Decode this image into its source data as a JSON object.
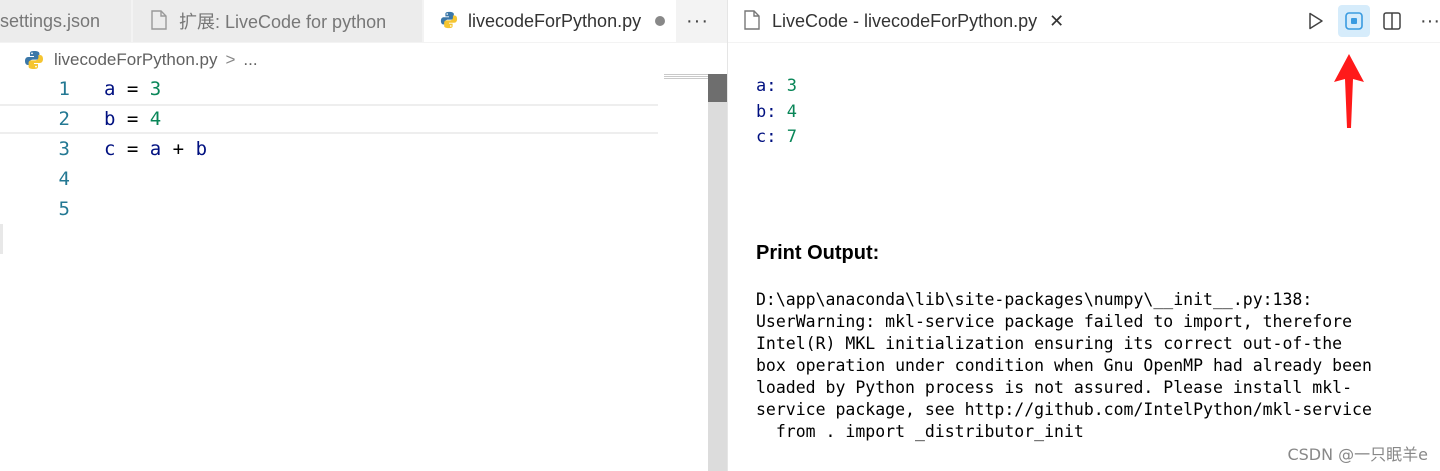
{
  "left_tabs": [
    {
      "label": "settings.json",
      "icon": "json-file-icon"
    },
    {
      "label": "扩展: LiveCode for python",
      "icon": "file-icon"
    },
    {
      "label": "livecodeForPython.py",
      "icon": "python-icon",
      "modified": true
    }
  ],
  "left_more": "···",
  "breadcrumb": {
    "file": "livecodeForPython.py",
    "separator": ">",
    "ellipsis": "..."
  },
  "editor": {
    "lines": [
      {
        "num": "1",
        "parts": [
          [
            "var",
            "a"
          ],
          [
            "op",
            " = "
          ],
          [
            "num",
            "3"
          ]
        ]
      },
      {
        "num": "2",
        "parts": [
          [
            "var",
            "b"
          ],
          [
            "op",
            " = "
          ],
          [
            "num",
            "4"
          ]
        ]
      },
      {
        "num": "3",
        "parts": [
          [
            "var",
            "c"
          ],
          [
            "op",
            " = "
          ],
          [
            "var",
            "a"
          ],
          [
            "op",
            " + "
          ],
          [
            "var",
            "b"
          ]
        ]
      },
      {
        "num": "4",
        "parts": []
      },
      {
        "num": "5",
        "parts": []
      }
    ],
    "current_line": 2
  },
  "right_tab": {
    "label": "LiveCode - livecodeForPython.py",
    "close": "✕"
  },
  "right_actions": [
    "run-icon",
    "live-preview-icon",
    "split-editor-icon",
    "more-actions-icon"
  ],
  "right_more": "···",
  "variables": [
    {
      "name": "a:",
      "value": "3"
    },
    {
      "name": "b:",
      "value": "4"
    },
    {
      "name": "c:",
      "value": "7"
    }
  ],
  "print_output": {
    "title": "Print Output:",
    "lines": [
      "D:\\app\\anaconda\\lib\\site-packages\\numpy\\__init__.py:138:",
      "UserWarning: mkl-service package failed to import, therefore",
      "Intel(R) MKL initialization ensuring its correct out-of-the",
      "box operation under condition when Gnu OpenMP had already been",
      "loaded by Python process is not assured. Please install mkl-",
      "service package, see http://github.com/IntelPython/mkl-service",
      "  from . import _distributor_init"
    ]
  },
  "watermark": "CSDN @一只眠羊e",
  "colors": {
    "accent_arrow": "#ff1a1a",
    "line_number": "#237893",
    "variable": "#001080",
    "number": "#098658"
  }
}
